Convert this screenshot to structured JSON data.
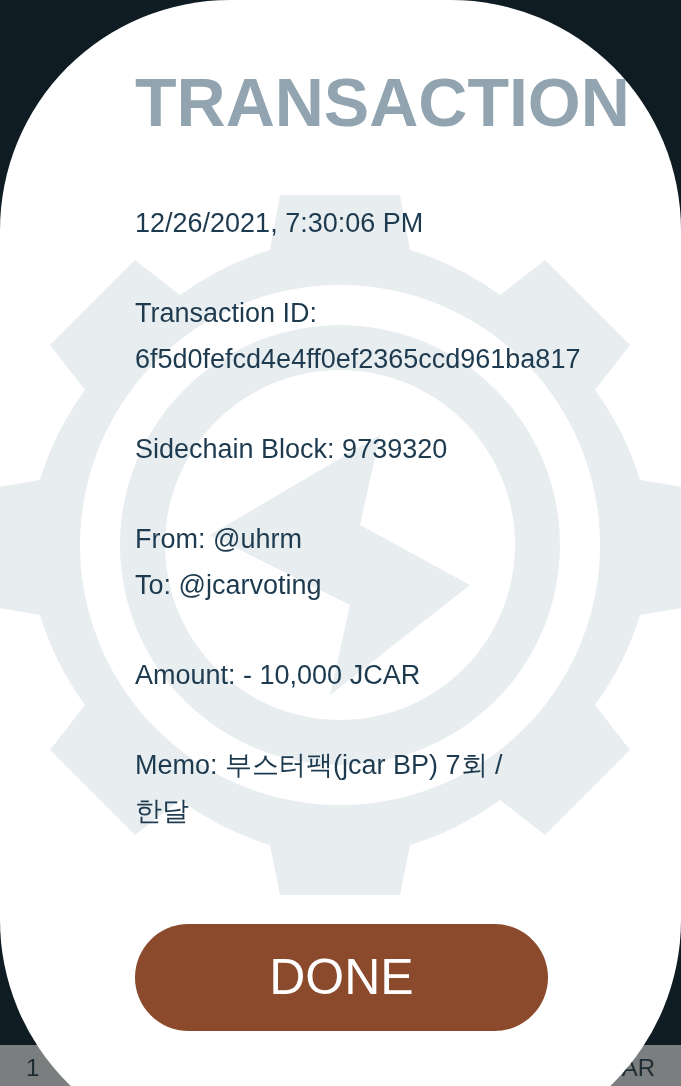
{
  "background_row": {
    "left_text": "1",
    "right_text": "AR"
  },
  "dialog": {
    "title": "TRANSACTION",
    "lines": [
      {
        "kind": "single",
        "text": "12/26/2021, 7:30:06 PM"
      },
      {
        "kind": "stacked",
        "text": "Transaction ID:",
        "value": "6f5d0fefcd4e4ff0ef2365ccd961ba817"
      },
      {
        "kind": "single",
        "text": "Sidechain Block: 9739320"
      },
      {
        "kind": "pair",
        "text": "From: @uhrm",
        "value": "To: @jcarvoting"
      },
      {
        "kind": "single",
        "text": "Amount: - 10,000 JCAR"
      },
      {
        "kind": "memo",
        "text": "Memo: 부스터팩(jcar BP) 7회 / 한달"
      }
    ],
    "button": "DONE"
  }
}
